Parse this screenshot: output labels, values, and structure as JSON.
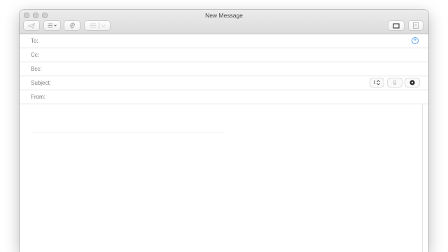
{
  "window": {
    "title": "New Message"
  },
  "toolbar": {
    "send_icon": "paper-plane-icon",
    "header_fields_icon": "list-icon",
    "attach_icon": "paperclip-icon",
    "format_icon": "text-format-icon",
    "photo_browser_icon": "photo-browser-icon",
    "stationery_icon": "stationery-icon"
  },
  "fields": {
    "to_label": "To:",
    "cc_label": "Cc:",
    "bcc_label": "Bcc:",
    "subject_label": "Subject:",
    "from_label": "From:",
    "priority_label": "!",
    "add_contact_icon": "plus-circle-icon",
    "lock_icon": "lock-icon",
    "signature_icon": "gear-icon"
  },
  "colors": {
    "accent": "#5aa2f0"
  }
}
